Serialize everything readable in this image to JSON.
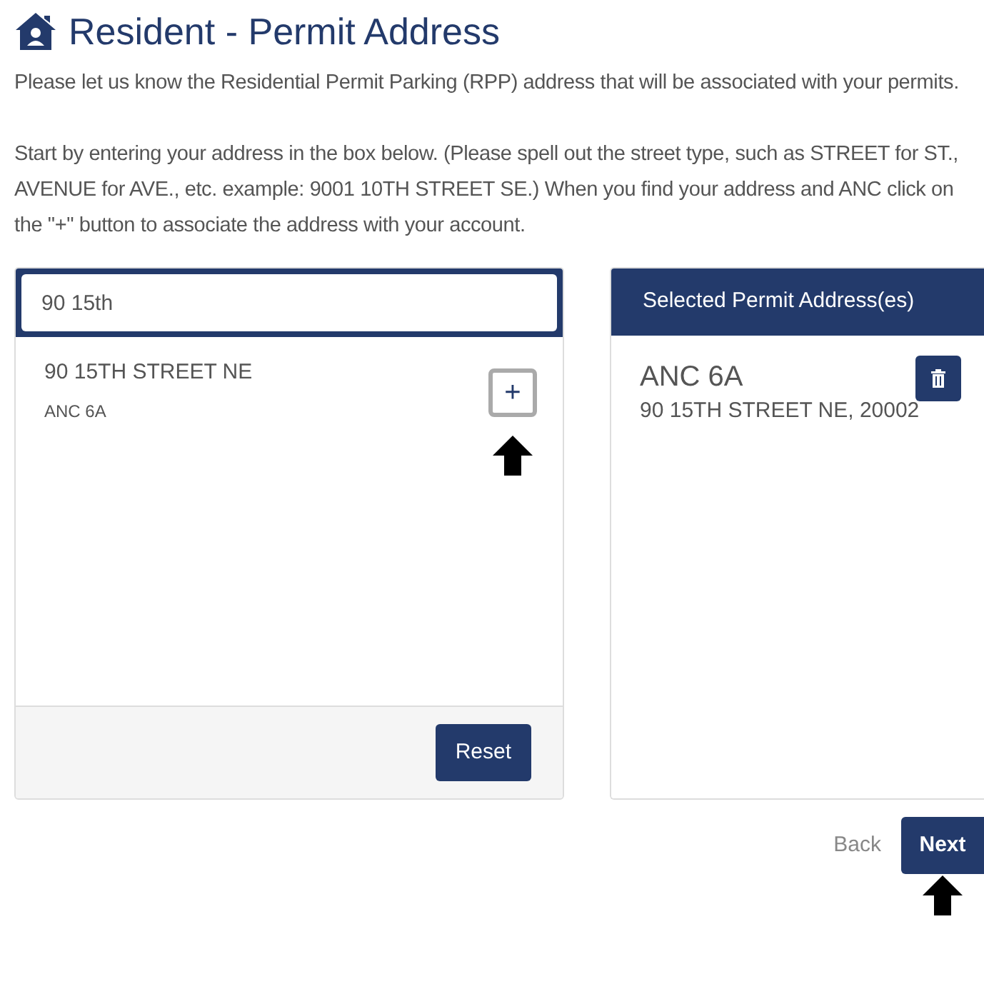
{
  "title": "Resident - Permit Address",
  "intro": [
    "Please let us know the Residential Permit Parking (RPP) address that will be associated with your permits.",
    "Start by entering your address in the box below. (Please spell out the street type, such as STREET for ST., AVENUE for AVE., etc. example: 9001 10TH STREET SE.) When you find your address and ANC click on the \"+\" button to associate the address with your account."
  ],
  "search": {
    "value": "90 15th",
    "results": [
      {
        "address": "90 15TH STREET NE",
        "anc": "ANC 6A",
        "add_label": "+"
      }
    ],
    "reset": "Reset"
  },
  "selected_panel": {
    "title": "Selected Permit Address(es)",
    "items": [
      {
        "anc": "ANC 6A",
        "address": "90 15TH STREET NE, 20002"
      }
    ]
  },
  "nav": {
    "back": "Back",
    "next": "Next"
  }
}
